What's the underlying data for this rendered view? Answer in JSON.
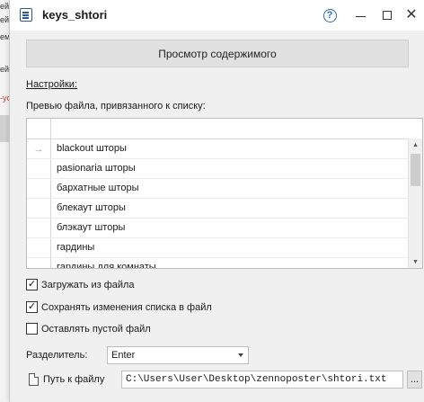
{
  "background": {
    "lines": [
      "ей",
      "ей",
      "еме",
      "ейс",
      "-you"
    ]
  },
  "window": {
    "title": "keys_shtori",
    "help_glyph": "?",
    "icons": [
      "list-window-icon",
      "help-icon",
      "minimize-icon",
      "maximize-icon",
      "close-icon"
    ]
  },
  "main": {
    "view_button_label": "Просмотр содержимого",
    "settings_link": "Настройки:",
    "preview_label": "Превью файла, привязанного к списку:",
    "current_row_marker": "→",
    "rows": [
      "blackout шторы",
      "pasionaria шторы",
      "бархатные шторы",
      "блекаут шторы",
      "блэкаут шторы",
      "гардины",
      "гардины для комнаты"
    ],
    "scroll_position": 0.1
  },
  "options": {
    "load_from_file": {
      "label": "Загружать из файла",
      "checked": true
    },
    "save_changes": {
      "label": "Сохранять изменения списка в файл",
      "checked": true
    },
    "keep_empty": {
      "label": "Оставлять пустой файл",
      "checked": false
    },
    "check_glyph": "✓"
  },
  "separator": {
    "label": "Разделитель:",
    "value": "Enter"
  },
  "path": {
    "label": "Путь к файлу",
    "value": "C:\\Users\\User\\Desktop\\zennoposter\\shtori.txt",
    "browse_label": "..."
  },
  "colors": {
    "accent": "#2b6cb0",
    "dialog_bg": "#f0f0f0",
    "button_bg": "#e1e1e1"
  }
}
